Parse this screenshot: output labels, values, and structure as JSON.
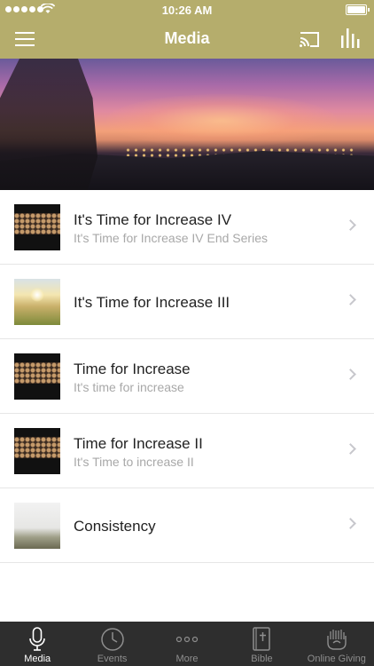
{
  "status_bar": {
    "time": "10:26 AM"
  },
  "nav": {
    "title": "Media",
    "icons": [
      "menu-icon",
      "cast-icon",
      "equalizer-icon"
    ]
  },
  "media_items": [
    {
      "title": "It's Time for Increase  IV",
      "subtitle": "It's Time for Increase IV  End Series",
      "thumbnail": "crowd"
    },
    {
      "title": "It's Time for Increase III",
      "subtitle": "",
      "thumbnail": "sunrise-field"
    },
    {
      "title": "Time for Increase",
      "subtitle": "It's time for increase",
      "thumbnail": "crowd"
    },
    {
      "title": "Time for Increase II",
      "subtitle": "It's Time to increase II",
      "thumbnail": "crowd"
    },
    {
      "title": "Consistency",
      "subtitle": "",
      "thumbnail": "misty-hills"
    }
  ],
  "tab_bar": {
    "tabs": [
      {
        "label": "Media",
        "icon": "microphone-icon",
        "active": true
      },
      {
        "label": "Events",
        "icon": "clock-icon",
        "active": false
      },
      {
        "label": "More",
        "icon": "more-dots-icon",
        "active": false
      },
      {
        "label": "Bible",
        "icon": "bible-icon",
        "active": false
      },
      {
        "label": "Online Giving",
        "icon": "giving-hands-icon",
        "active": false
      }
    ]
  },
  "colors": {
    "accent": "#b5ad6c",
    "tab_bar_bg": "#2e2e2e",
    "subtitle": "#a8a8a8"
  }
}
